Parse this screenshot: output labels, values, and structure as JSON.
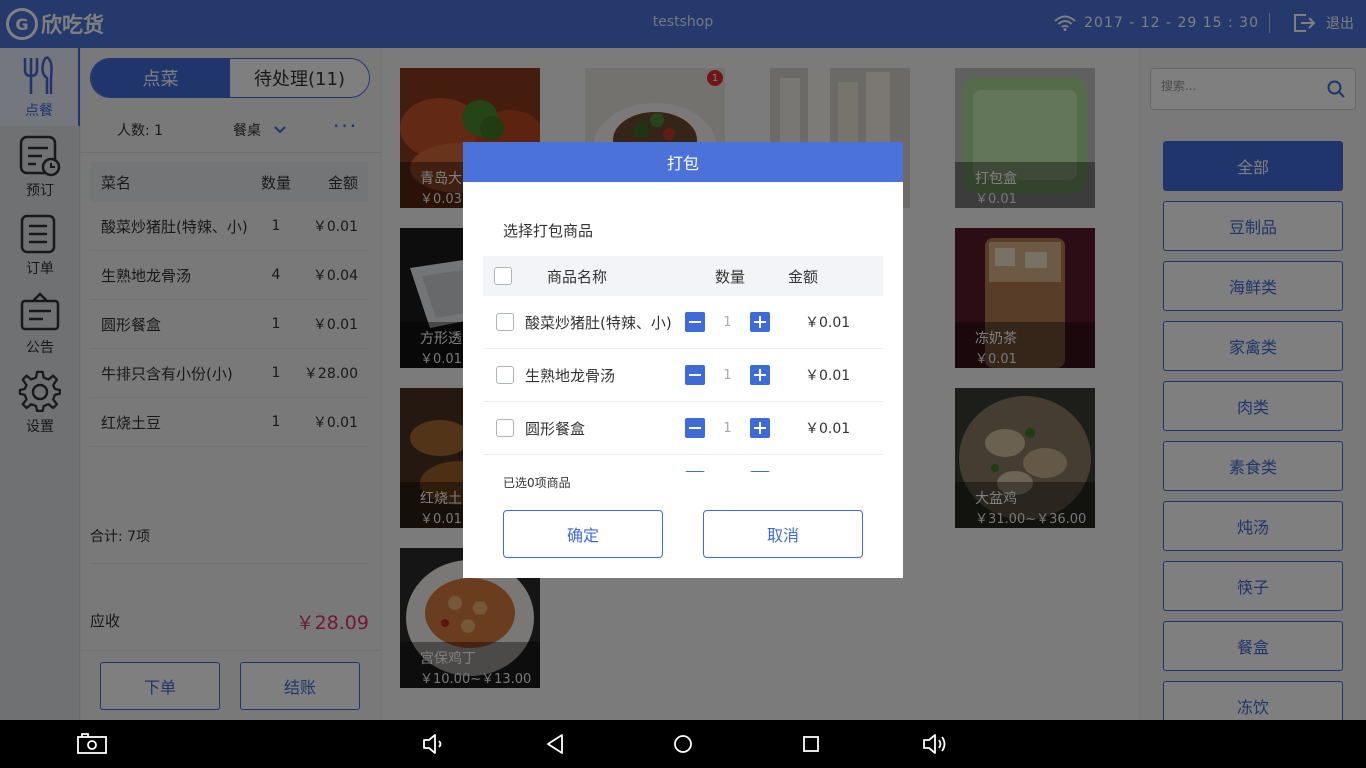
{
  "app": {
    "logo_text": "欣吃货",
    "shop_name": "testshop",
    "datetime": "2017 - 12 - 29  15 : 30",
    "logout_label": "退出"
  },
  "nav": {
    "items": [
      {
        "label": "点餐",
        "icon": "fork-knife-icon"
      },
      {
        "label": "预订",
        "icon": "reservation-icon"
      },
      {
        "label": "订单",
        "icon": "order-list-icon"
      },
      {
        "label": "公告",
        "icon": "notice-board-icon"
      },
      {
        "label": "设置",
        "icon": "gear-icon"
      }
    ]
  },
  "order": {
    "tabs": [
      "点菜",
      "待处理(11)"
    ],
    "people_label": "人数: 1",
    "table_label": "餐桌",
    "more_label": "···",
    "columns": [
      "菜名",
      "数量",
      "金额"
    ],
    "items": [
      {
        "name": "酸菜炒猪肚(特辣、小)",
        "qty": "1",
        "amount": "￥0.01"
      },
      {
        "name": "生熟地龙骨汤",
        "qty": "4",
        "amount": "￥0.04"
      },
      {
        "name": "圆形餐盒",
        "qty": "1",
        "amount": "￥0.01"
      },
      {
        "name": "牛排只含有小份(小)",
        "qty": "1",
        "amount": "￥28.00"
      },
      {
        "name": "红烧土豆",
        "qty": "1",
        "amount": "￥0.01"
      }
    ],
    "total_label": "合计:   7项",
    "due_label": "应收",
    "due_value": "￥28.09",
    "submit_label": "下单",
    "checkout_label": "结账"
  },
  "menu": {
    "dishes": [
      {
        "name": "青岛大",
        "price": "￥0.03"
      },
      {
        "name": "",
        "price": "",
        "badge": "1"
      },
      {
        "name": "",
        "price": ""
      },
      {
        "name": "打包盒",
        "price": "￥0.01"
      },
      {
        "name": "方形透",
        "price": "￥0.01"
      },
      {
        "name": "冻奶茶",
        "price": "￥0.01"
      },
      {
        "name": "红烧土",
        "price": "￥0.01"
      },
      {
        "name": "大盆鸡",
        "price": "￥31.00~￥36.00"
      },
      {
        "name": "宫保鸡丁",
        "price": "￥10.00~￥13.00"
      }
    ]
  },
  "sidebar": {
    "search_placeholder": "搜索...",
    "categories": [
      "全部",
      "豆制品",
      "海鲜类",
      "家禽类",
      "肉类",
      "素食类",
      "炖汤",
      "筷子",
      "餐盒",
      "冻饮"
    ]
  },
  "dialog": {
    "title": "打包",
    "subtitle": "选择打包商品",
    "columns": [
      "商品名称",
      "数量",
      "金额"
    ],
    "items": [
      {
        "name": "酸菜炒猪肚(特辣、小)",
        "qty": "1",
        "amount": "￥0.01"
      },
      {
        "name": "生熟地龙骨汤",
        "qty": "1",
        "amount": "￥0.01"
      },
      {
        "name": "圆形餐盒",
        "qty": "1",
        "amount": "￥0.01"
      }
    ],
    "selected_text": "已选0项商品",
    "confirm_label": "确定",
    "cancel_label": "取消"
  },
  "system_bar": {
    "icons": [
      "screenshot-icon",
      "volume-down-icon",
      "back-icon",
      "home-icon",
      "recents-icon",
      "volume-up-icon"
    ]
  },
  "colors": {
    "primary": "#4a72d9",
    "accent_blue": "#3f6bd8",
    "due_red": "#e0346a"
  }
}
